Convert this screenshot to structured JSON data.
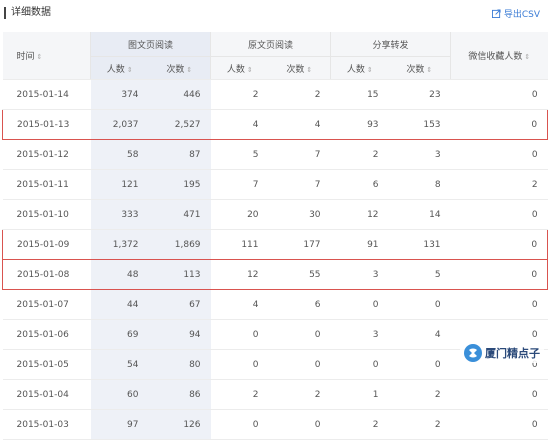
{
  "header": {
    "title": "详细数据",
    "export_label": "导出CSV"
  },
  "table": {
    "columns": {
      "time": "时间",
      "graphic_read": "图文页阅读",
      "original_read": "原文页阅读",
      "share": "分享转发",
      "wechat_fav": "微信收藏人数",
      "people": "人数",
      "times": "次数"
    },
    "rows": [
      {
        "date": "2015-01-14",
        "gr_people": "374",
        "gr_times": "446",
        "or_people": "2",
        "or_times": "2",
        "sh_people": "15",
        "sh_times": "23",
        "fav": "0"
      },
      {
        "date": "2015-01-13",
        "gr_people": "2,037",
        "gr_times": "2,527",
        "or_people": "4",
        "or_times": "4",
        "sh_people": "93",
        "sh_times": "153",
        "fav": "0"
      },
      {
        "date": "2015-01-12",
        "gr_people": "58",
        "gr_times": "87",
        "or_people": "5",
        "or_times": "7",
        "sh_people": "2",
        "sh_times": "3",
        "fav": "0"
      },
      {
        "date": "2015-01-11",
        "gr_people": "121",
        "gr_times": "195",
        "or_people": "7",
        "or_times": "7",
        "sh_people": "6",
        "sh_times": "8",
        "fav": "2"
      },
      {
        "date": "2015-01-10",
        "gr_people": "333",
        "gr_times": "471",
        "or_people": "20",
        "or_times": "30",
        "sh_people": "12",
        "sh_times": "14",
        "fav": "0"
      },
      {
        "date": "2015-01-09",
        "gr_people": "1,372",
        "gr_times": "1,869",
        "or_people": "111",
        "or_times": "177",
        "sh_people": "91",
        "sh_times": "131",
        "fav": "0"
      },
      {
        "date": "2015-01-08",
        "gr_people": "48",
        "gr_times": "113",
        "or_people": "12",
        "or_times": "55",
        "sh_people": "3",
        "sh_times": "5",
        "fav": "0"
      },
      {
        "date": "2015-01-07",
        "gr_people": "44",
        "gr_times": "67",
        "or_people": "4",
        "or_times": "6",
        "sh_people": "0",
        "sh_times": "0",
        "fav": "0"
      },
      {
        "date": "2015-01-06",
        "gr_people": "69",
        "gr_times": "94",
        "or_people": "0",
        "or_times": "0",
        "sh_people": "3",
        "sh_times": "4",
        "fav": "0"
      },
      {
        "date": "2015-01-05",
        "gr_people": "54",
        "gr_times": "80",
        "or_people": "0",
        "or_times": "0",
        "sh_people": "0",
        "sh_times": "0",
        "fav": "0"
      },
      {
        "date": "2015-01-04",
        "gr_people": "60",
        "gr_times": "86",
        "or_people": "2",
        "or_times": "2",
        "sh_people": "1",
        "sh_times": "2",
        "fav": "0"
      },
      {
        "date": "2015-01-03",
        "gr_people": "97",
        "gr_times": "126",
        "or_people": "0",
        "or_times": "0",
        "sh_people": "2",
        "sh_times": "2",
        "fav": "0"
      }
    ]
  },
  "watermark": {
    "text": "厦门精点子"
  },
  "colors": {
    "accent": "#3a7bd5",
    "highlight": "#d9534f",
    "header_bg": "#f5f6f8",
    "shaded_col": "#eef1f7"
  }
}
